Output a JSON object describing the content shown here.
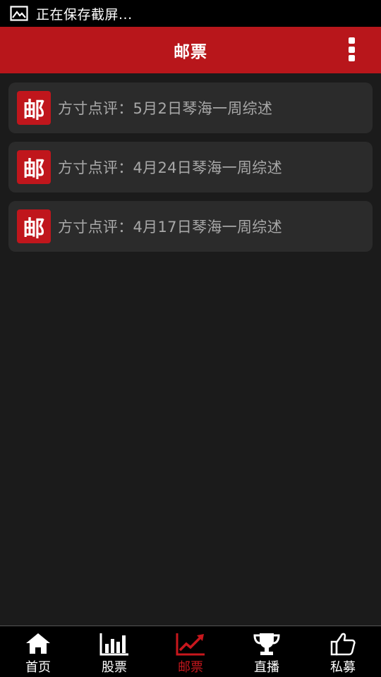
{
  "status_bar": {
    "icon": "image-icon",
    "text": "正在保存截屏..."
  },
  "app_bar": {
    "title": "邮票",
    "menu_icon": "more-vertical-icon"
  },
  "list": {
    "items": [
      {
        "badge": "邮",
        "title": "方寸点评：5月2日琴海一周综述"
      },
      {
        "badge": "邮",
        "title": "方寸点评：4月24日琴海一周综述"
      },
      {
        "badge": "邮",
        "title": "方寸点评：4月17日琴海一周综述"
      }
    ]
  },
  "tab_bar": {
    "active_index": 2,
    "active_color": "#c8171d",
    "tabs": [
      {
        "label": "首页",
        "icon": "home-icon"
      },
      {
        "label": "股票",
        "icon": "bar-chart-icon"
      },
      {
        "label": "邮票",
        "icon": "trend-line-icon"
      },
      {
        "label": "直播",
        "icon": "trophy-icon"
      },
      {
        "label": "私募",
        "icon": "thumbs-up-icon"
      }
    ]
  },
  "colors": {
    "app_bar": "#b8161b",
    "background": "#1b1b1b",
    "card": "#2b2b2b",
    "badge": "#c0161c"
  }
}
